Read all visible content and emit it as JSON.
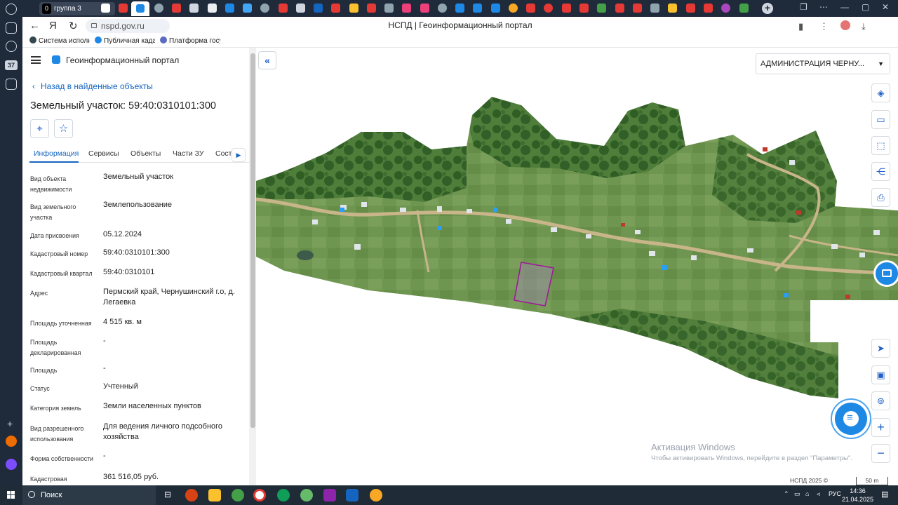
{
  "browser": {
    "tab_group": {
      "count": "0",
      "label": "группа 3"
    },
    "rail_badge": "37",
    "url": "nspd.gov.ru",
    "page_title": "НСПД | Геоинформационный портал",
    "bookmarks": [
      "Система исполне",
      "Публичная кадас",
      "Платформа госуд"
    ]
  },
  "panel": {
    "portal_name": "Геоинформационный портал",
    "back_link": "Назад в найденные объекты",
    "title": "Земельный участок: 59:40:0310101:300",
    "tabs": [
      "Информация",
      "Сервисы",
      "Объекты",
      "Части ЗУ",
      "Соста"
    ],
    "rows": [
      {
        "label": "Вид объекта недвижимости",
        "value": "Земельный участок"
      },
      {
        "label": "Вид земельного участка",
        "value": "Землепользование"
      },
      {
        "label": "Дата присвоения",
        "value": "05.12.2024"
      },
      {
        "label": "Кадастровый номер",
        "value": "59:40:0310101:300"
      },
      {
        "label": "Кадастровый квартал",
        "value": "59:40:0310101"
      },
      {
        "label": "Адрес",
        "value": "Пермский край, Чернушинский г.о, д. Легаевка"
      },
      {
        "label": "Площадь уточненная",
        "value": "4 515 кв. м"
      },
      {
        "label": "Площадь декларированная",
        "value": "-"
      },
      {
        "label": "Площадь",
        "value": "-"
      },
      {
        "label": "Статус",
        "value": "Учтенный"
      },
      {
        "label": "Категория земель",
        "value": "Земли населенных пунктов"
      },
      {
        "label": "Вид разрешенного использования",
        "value": "Для ведения личного подсобного хозяйства"
      },
      {
        "label": "Форма собственности",
        "value": "-"
      },
      {
        "label": "Кадастровая",
        "value": "361 516,05 руб."
      }
    ]
  },
  "map": {
    "admin_select": "АДМИНИСТРАЦИЯ ЧЕРНУ...",
    "activation_title": "Активация Windows",
    "activation_text": "Чтобы активировать Windows, перейдите в раздел \"Параметры\".",
    "attribution": "НСПД 2025 ©",
    "scale": "50 m",
    "colors": {
      "parcel": "#a0199c",
      "accent": "#1e88e5"
    }
  },
  "taskbar": {
    "search": "Поиск",
    "lang": "РУС",
    "time": "14:36",
    "date": "21.04.2025"
  }
}
